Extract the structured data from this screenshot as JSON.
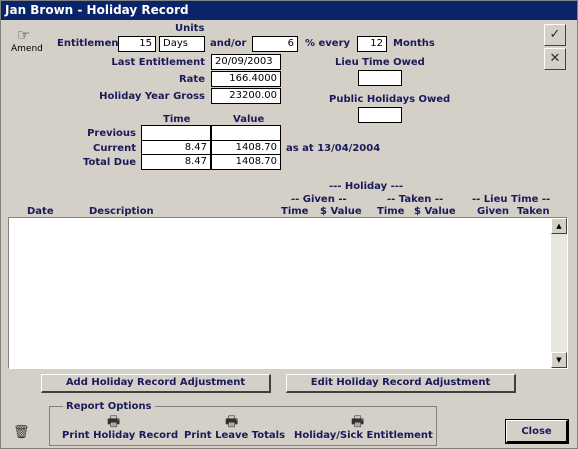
{
  "window": {
    "title": "Jan Brown - Holiday Record"
  },
  "amend": {
    "label": "Amend",
    "icon": "pointing-hand-icon"
  },
  "entitlement": {
    "label": "Entitlement",
    "units_header": "Units",
    "value": "15",
    "units": "Days",
    "andor_label": "and/or",
    "percent": "6",
    "percent_every_label": "% every",
    "months": "12",
    "months_label": "Months"
  },
  "last_entitlement": {
    "label": "Last Entitlement",
    "value": "20/09/2003"
  },
  "rate": {
    "label": "Rate",
    "value": "166.4000"
  },
  "holiday_year_gross": {
    "label": "Holiday Year Gross",
    "value": "23200.00"
  },
  "lieu_time_owed": {
    "label": "Lieu Time Owed",
    "value": ""
  },
  "public_holidays_owed": {
    "label": "Public Holidays Owed",
    "value": ""
  },
  "summary": {
    "time_header": "Time",
    "value_header": "Value",
    "rows": [
      {
        "label": "Previous",
        "time": "",
        "value": ""
      },
      {
        "label": "Current",
        "time": "8.47",
        "value": "1408.70"
      },
      {
        "label": "Total Due",
        "time": "8.47",
        "value": "1408.70"
      }
    ],
    "as_at": "as at 13/04/2004"
  },
  "table": {
    "holiday_header": "--- Holiday ---",
    "given_header": "-- Given --",
    "taken_header": "-- Taken --",
    "lieu_header": "-- Lieu Time --",
    "columns": {
      "date": "Date",
      "description": "Description",
      "given_time": "Time",
      "given_value": "$ Value",
      "taken_time": "Time",
      "taken_value": "$ Value",
      "lieu_given": "Given",
      "lieu_taken": "Taken"
    },
    "rows": []
  },
  "buttons": {
    "add_adjustment": "Add Holiday Record Adjustment",
    "edit_adjustment": "Edit Holiday Record Adjustment",
    "close": "Close"
  },
  "report_options": {
    "title": "Report Options",
    "print_holiday_record": "Print Holiday Record",
    "print_leave_totals": "Print Leave Totals",
    "holiday_sick_entitlement": "Holiday/Sick Entitlement"
  },
  "toolbar": {
    "ok_icon": "checkmark-icon",
    "cancel_icon": "close-x-icon",
    "delete_icon": "trash-icon"
  }
}
